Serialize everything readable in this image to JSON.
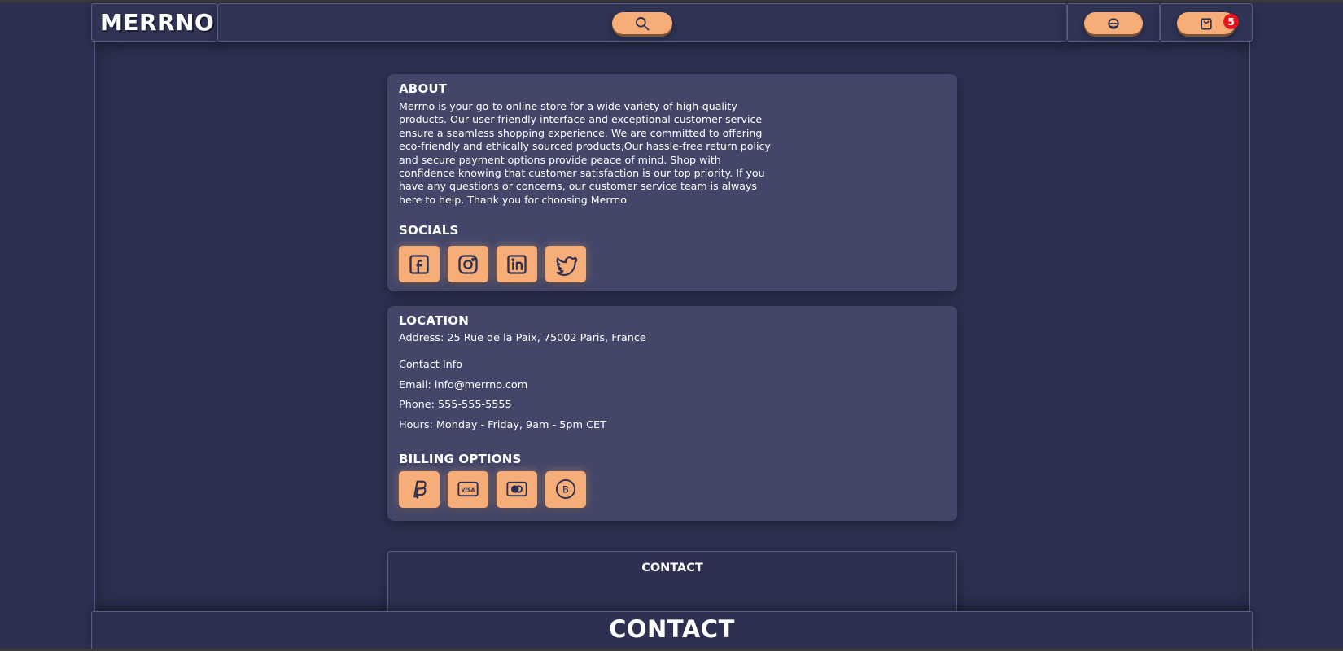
{
  "header": {
    "logo": "MERRNO",
    "cart_count": "5",
    "search_icon": "search-icon",
    "support_icon": "headset-icon",
    "cart_icon": "shopping-bag-icon"
  },
  "about": {
    "title": "ABOUT",
    "text": "Merrno is your go-to online store for a wide variety of high-quality products. Our user-friendly interface and exceptional customer service ensure a seamless shopping experience. We are committed to offering eco-friendly and ethically sourced products,Our hassle-free return policy and secure payment options provide peace of mind. Shop with confidence knowing that customer satisfaction is our top priority. If you have any questions or concerns, our customer service team is always here to help. Thank you for choosing Merrno"
  },
  "socials": {
    "title": "SOCIALS",
    "icons": [
      "facebook-icon",
      "instagram-icon",
      "linkedin-icon",
      "twitter-icon"
    ]
  },
  "location": {
    "title": "LOCATION",
    "address": "Address: 25 Rue de la Paix, 75002 Paris, France",
    "contact_info": "Contact Info",
    "email": "Email: info@merrno.com",
    "phone": "Phone: 555-555-5555",
    "hours": "Hours: Monday - Friday, 9am - 5pm CET"
  },
  "billing": {
    "title": "BILLING OPTIONS",
    "icons": [
      "paypal-icon",
      "visa-icon",
      "mastercard-icon",
      "bitcoin-icon"
    ]
  },
  "contact_section": {
    "title": "CONTACT"
  },
  "footer": {
    "title": "CONTACT"
  },
  "colors": {
    "background": "#2d3050",
    "card": "#434668",
    "accent": "#f6ad78",
    "badge": "#e8141b"
  }
}
